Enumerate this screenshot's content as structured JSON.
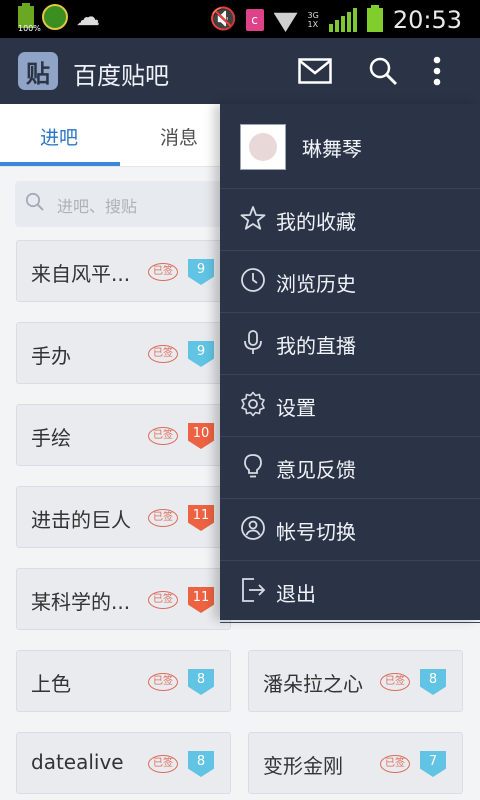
{
  "status_bar": {
    "battery_label": "100%",
    "time": "20:53",
    "network": "3G",
    "network_sub": "1X",
    "app_letter": "c"
  },
  "app_bar": {
    "title": "百度贴吧",
    "logo_char": "贴",
    "icons": [
      "mail-icon",
      "search-icon",
      "more-vert-icon"
    ]
  },
  "tabs": [
    {
      "label": "进吧",
      "active": true
    },
    {
      "label": "消息",
      "active": false
    }
  ],
  "search": {
    "placeholder": "进吧、搜贴"
  },
  "forums": [
    {
      "name": "来自风平...",
      "stamp": "已签",
      "level": "9",
      "badge_color": "#62c4e4"
    },
    {
      "name": "手办",
      "stamp": "已签",
      "level": "9",
      "badge_color": "#62c4e4"
    },
    {
      "name": "手绘",
      "stamp": "已签",
      "level": "10",
      "badge_color": "#ec6242"
    },
    {
      "name": "进击的巨人",
      "stamp": "已签",
      "level": "11",
      "badge_color": "#ec6242"
    },
    {
      "name": "某科学的...",
      "stamp": "已签",
      "level": "11",
      "badge_color": "#ec6242"
    },
    {
      "name": "上色",
      "stamp": "已签",
      "level": "8",
      "badge_color": "#62c4e4"
    },
    {
      "name": "潘朵拉之心",
      "stamp": "已签",
      "level": "8",
      "badge_color": "#62c4e4"
    },
    {
      "name": "datealive",
      "stamp": "已签",
      "level": "8",
      "badge_color": "#62c4e4"
    },
    {
      "name": "变形金刚",
      "stamp": "已签",
      "level": "7",
      "badge_color": "#62c4e4"
    }
  ],
  "drawer": {
    "user_name": "琳舞琴",
    "items": [
      {
        "label": "我的收藏",
        "icon": "star-icon"
      },
      {
        "label": "浏览历史",
        "icon": "clock-icon"
      },
      {
        "label": "我的直播",
        "icon": "microphone-icon"
      },
      {
        "label": "设置",
        "icon": "gear-icon"
      },
      {
        "label": "意见反馈",
        "icon": "lightbulb-icon"
      },
      {
        "label": "帐号切换",
        "icon": "account-switch-icon"
      },
      {
        "label": "退出",
        "icon": "logout-icon"
      }
    ]
  },
  "colors": {
    "app_bar": "#2b3446",
    "accent_blue": "#2a76c6",
    "badge_blue": "#62c4e4",
    "badge_red": "#ec6242",
    "stamp_red": "#de6d5b"
  }
}
